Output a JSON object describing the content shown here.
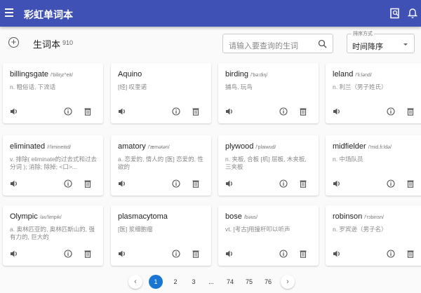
{
  "app": {
    "title": "彩虹单词本"
  },
  "toolbar": {
    "label": "生词本",
    "count": "910",
    "search_placeholder": "请输入要查询的生词",
    "sort_label": "排序方式",
    "sort_value": "时间降序"
  },
  "cards": [
    {
      "word": "billingsgate",
      "phonetic": "/'biliŋz^eit/",
      "meaning": "n. 粗俗话, 下流话"
    },
    {
      "word": "Aquino",
      "phonetic": "",
      "meaning": "[经] 叹奎诺"
    },
    {
      "word": "birding",
      "phonetic": "/'bə:diŋ/",
      "meaning": "捕鸟, 玩鸟"
    },
    {
      "word": "leland",
      "phonetic": "/'li:lənd/",
      "meaning": "n. 利兰（男子姓氏）"
    },
    {
      "word": "eliminated",
      "phonetic": "/i'limineitid/",
      "meaning": "v. 排除( eliminate的过去式和过去分词 ); 消除; 除掉; <口>..."
    },
    {
      "word": "amatory",
      "phonetic": "/'æmətəri/",
      "meaning": "a. 恋爱的, 情人的 [医] 恋爱的, 性欲的"
    },
    {
      "word": "plywood",
      "phonetic": "/'plaiwud/",
      "meaning": "n. 夹板, 合板 [机] 层板, 木夹板, 三夹板"
    },
    {
      "word": "midfielder",
      "phonetic": "/'mid.fi:ldə/",
      "meaning": "n. 中场队员"
    },
    {
      "word": "Olympic",
      "phonetic": "/əu'limpik/",
      "meaning": "a. 奥林匹亚的, 奥林匹斯山的, 强有力的, 巨大的"
    },
    {
      "word": "plasmacytoma",
      "phonetic": "",
      "meaning": "[医] 浆细胞瘤"
    },
    {
      "word": "bose",
      "phonetic": "/bəus/",
      "meaning": "vt. [考古]用撞杆叩以听声"
    },
    {
      "word": "robinson",
      "phonetic": "/'rɔbinsn/",
      "meaning": "n. 罗宾逊（男子名）"
    }
  ],
  "pagination": {
    "prev": "‹",
    "next": "›",
    "pages": [
      "1",
      "2",
      "3",
      "...",
      "74",
      "75",
      "76"
    ],
    "current": "1"
  },
  "colors": {
    "primary": "#3f51b5",
    "active_page": "#1976d2"
  }
}
